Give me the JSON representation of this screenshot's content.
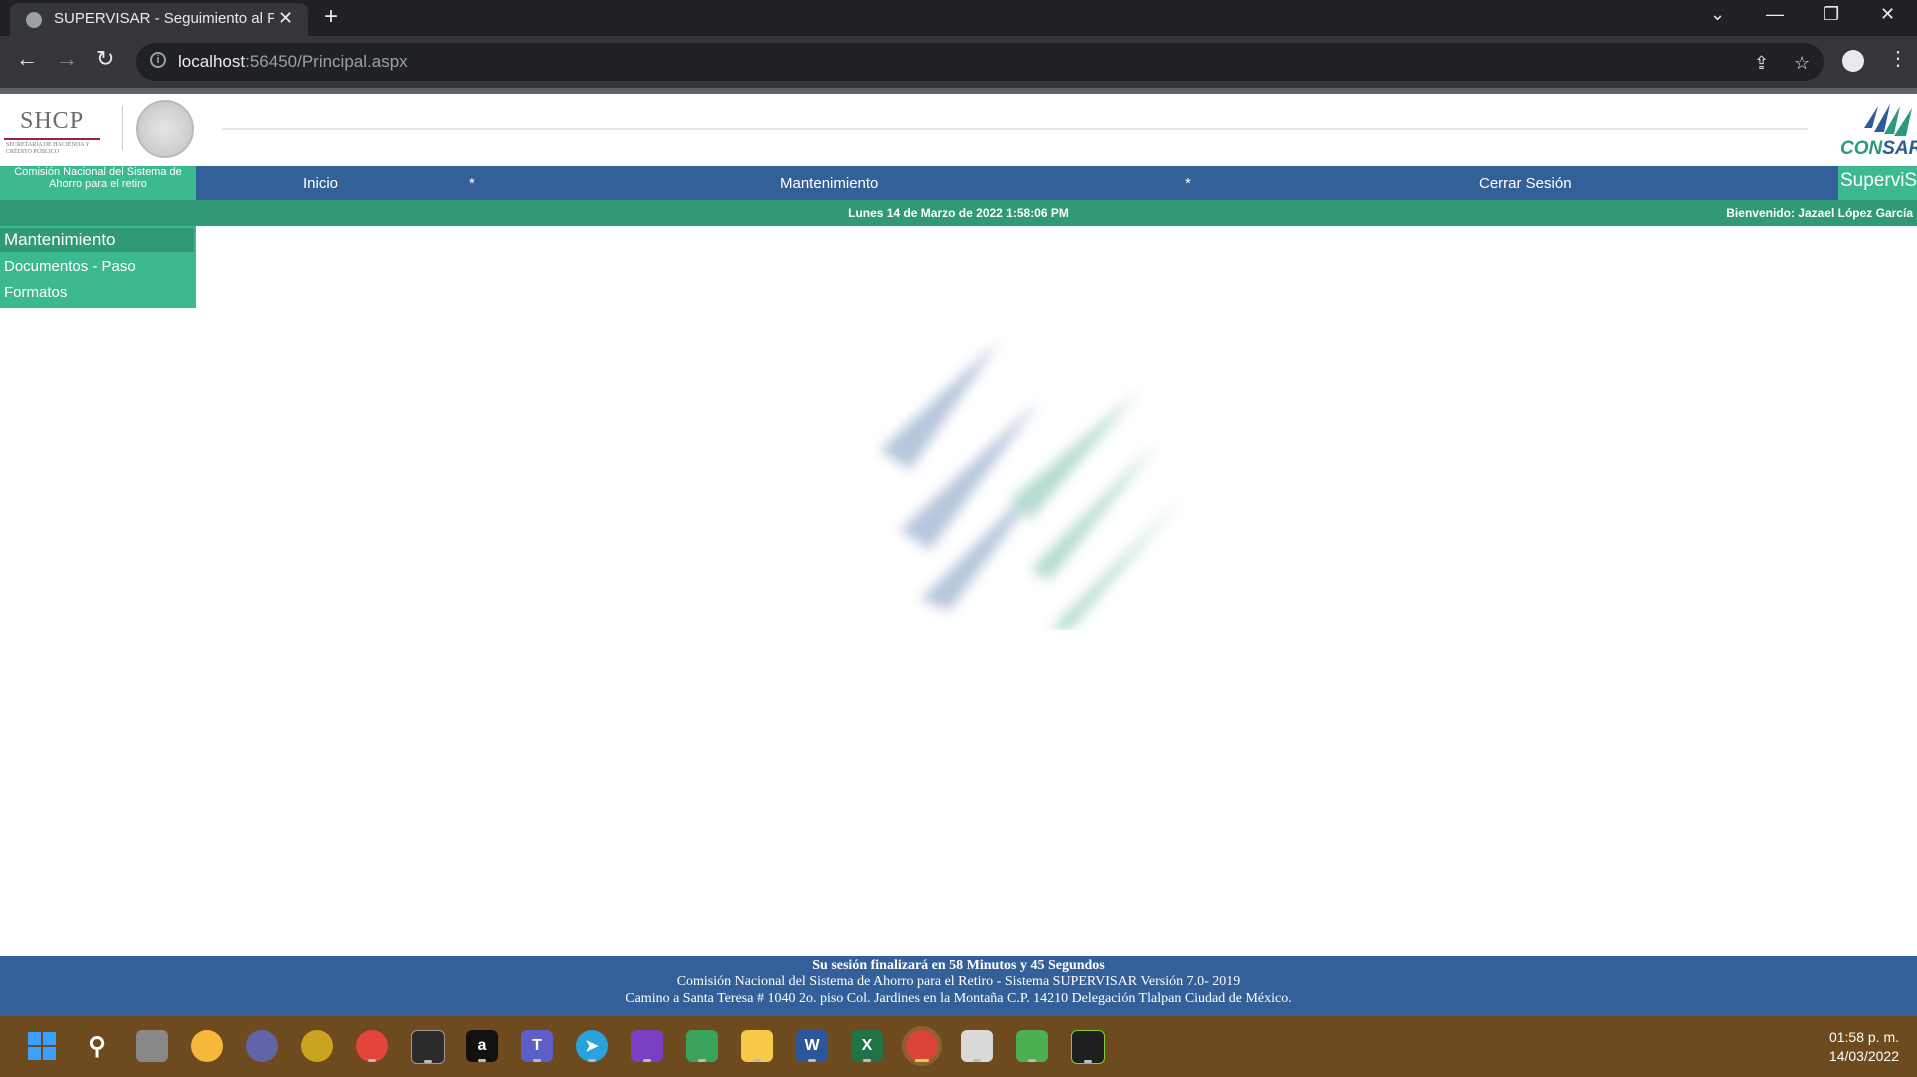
{
  "browser": {
    "tab_title": "SUPERVISAR - Seguimiento al Pro",
    "url_host": "localhost",
    "url_rest": ":56450/Principal.aspx",
    "new_tab": "+",
    "close_tab": "✕"
  },
  "header": {
    "shcp_logo_text": "SHCP",
    "shcp_subtitle": "SECRETARÍA DE HACIENDA Y CRÉDITO PÚBLICO",
    "consar_logo_con": "CON",
    "consar_logo_sar": "SAR"
  },
  "nav": {
    "comision": "Comisión Nacional del Sistema de Ahorro para el retiro",
    "items": [
      "Inicio",
      "*",
      "Mantenimiento",
      "*",
      "Cerrar Sesión"
    ],
    "supervis": "SuperviS"
  },
  "status": {
    "date": "Lunes 14 de Marzo de 2022 1:58:06 PM",
    "welcome": "Bienvenido: Jazael López García"
  },
  "sidemenu": {
    "header": "Mantenimiento",
    "items": [
      "Documentos - Paso",
      "Formatos"
    ]
  },
  "footer": {
    "session": "Su sesión finalizará en 58 Minutos y 45 Segundos",
    "line1": "Comisión Nacional del Sistema de Ahorro para el Retiro - Sistema SUPERVISAR Versión 7.0- 2019",
    "line2": "Camino a Santa Teresa # 1040 2o. piso Col. Jardines en la Montaña C.P. 14210 Delegación Tlalpan Ciudad de México."
  },
  "taskbar": {
    "time": "01:58 p. m.",
    "date": "14/03/2022",
    "icons": [
      "windows-start",
      "search",
      "task-view",
      "weather",
      "zoom",
      "app-chameleon",
      "chrome-profile",
      "terminal",
      "app-a",
      "teams",
      "telegram",
      "visual-studio",
      "app-notes",
      "file-explorer",
      "word",
      "excel",
      "chrome",
      "remote-desktop",
      "app-chart",
      "app-snip"
    ]
  },
  "colors": {
    "nav_blue": "#34609a",
    "green_accent": "#3cb98f",
    "status_green": "#2f9a74",
    "taskbar": "#6e4a1f"
  }
}
